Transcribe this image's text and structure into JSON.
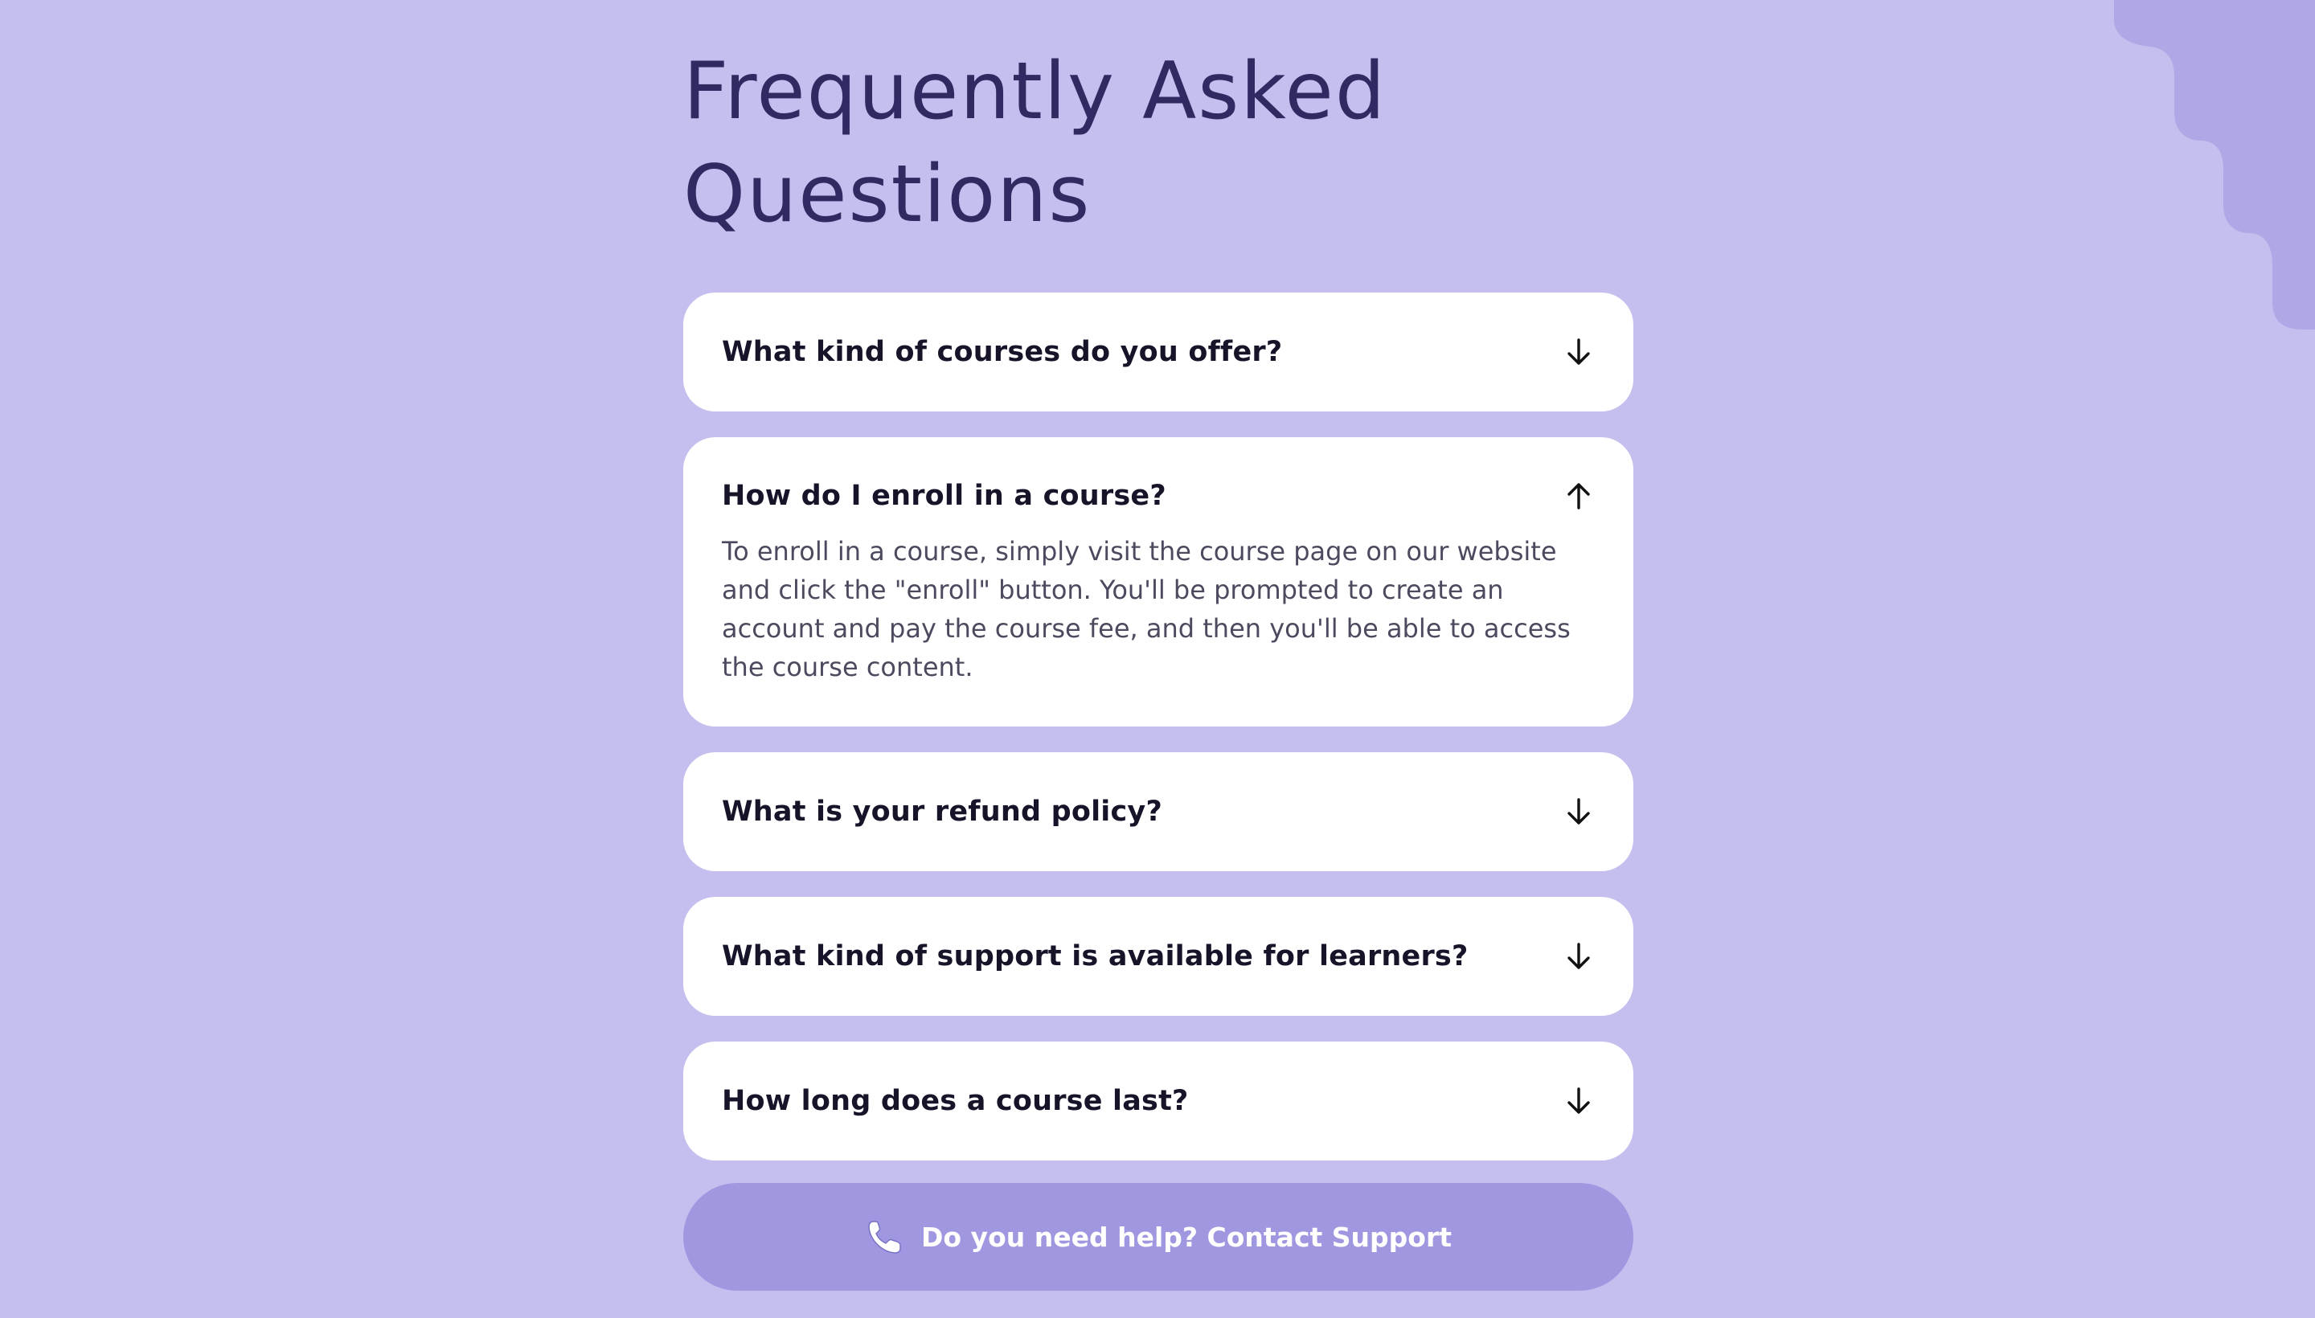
{
  "page": {
    "title": "Frequently Asked Questions"
  },
  "faq": [
    {
      "question": "What kind of courses do you offer?",
      "open": false,
      "icon": "arrow-down-icon"
    },
    {
      "question": "How do I enroll in a course?",
      "open": true,
      "icon": "arrow-up-icon",
      "answer": "To enroll in a course, simply visit the course page on our website and click the \"enroll\" button. You'll be prompted to create an account and pay the course fee, and then you'll be able to access the course content."
    },
    {
      "question": "What is your refund policy?",
      "open": false,
      "icon": "arrow-down-icon"
    },
    {
      "question": "What kind of support is available for learners?",
      "open": false,
      "icon": "arrow-down-icon"
    },
    {
      "question": "How long does a course last?",
      "open": false,
      "icon": "arrow-down-icon"
    }
  ],
  "support": {
    "label": "Do you need help? Contact Support",
    "icon": "phone-icon"
  },
  "colors": {
    "background": "#c4bfee",
    "title": "#312a62",
    "card": "#ffffff",
    "button": "#a097e1",
    "blob": "#afa8e6"
  }
}
